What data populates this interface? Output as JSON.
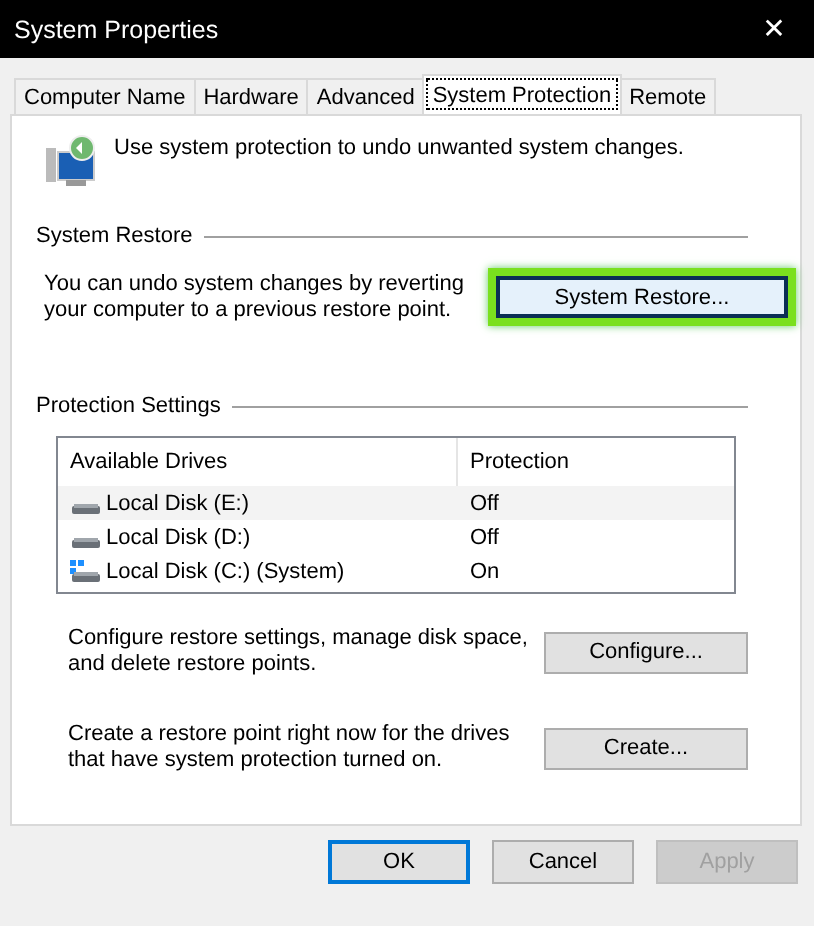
{
  "window": {
    "title": "System Properties",
    "close": "✕"
  },
  "tabs": [
    {
      "label": "Computer Name",
      "selected": false
    },
    {
      "label": "Hardware",
      "selected": false
    },
    {
      "label": "Advanced",
      "selected": false
    },
    {
      "label": "System Protection",
      "selected": true
    },
    {
      "label": "Remote",
      "selected": false
    }
  ],
  "intro": "Use system protection to undo unwanted system changes.",
  "system_restore": {
    "heading": "System Restore",
    "text": "You can undo system changes by reverting your computer to a previous restore point.",
    "button": "System Restore...",
    "highlighted": true
  },
  "protection_settings": {
    "heading": "Protection Settings",
    "columns": [
      "Available Drives",
      "Protection"
    ],
    "rows": [
      {
        "drive": "Local Disk (E:)",
        "protection": "Off",
        "kind": "disk",
        "selected": true
      },
      {
        "drive": "Local Disk (D:)",
        "protection": "Off",
        "kind": "disk",
        "selected": false
      },
      {
        "drive": "Local Disk (C:) (System)",
        "protection": "On",
        "kind": "system",
        "selected": false
      }
    ]
  },
  "configure": {
    "text": "Configure restore settings, manage disk space, and delete restore points.",
    "button": "Configure..."
  },
  "create": {
    "text": "Create a restore point right now for the drives that have system protection turned on.",
    "button": "Create..."
  },
  "buttons": [
    {
      "label": "OK",
      "default": true,
      "disabled": false
    },
    {
      "label": "Cancel",
      "default": false,
      "disabled": false
    },
    {
      "label": "Apply",
      "default": false,
      "disabled": true
    }
  ]
}
